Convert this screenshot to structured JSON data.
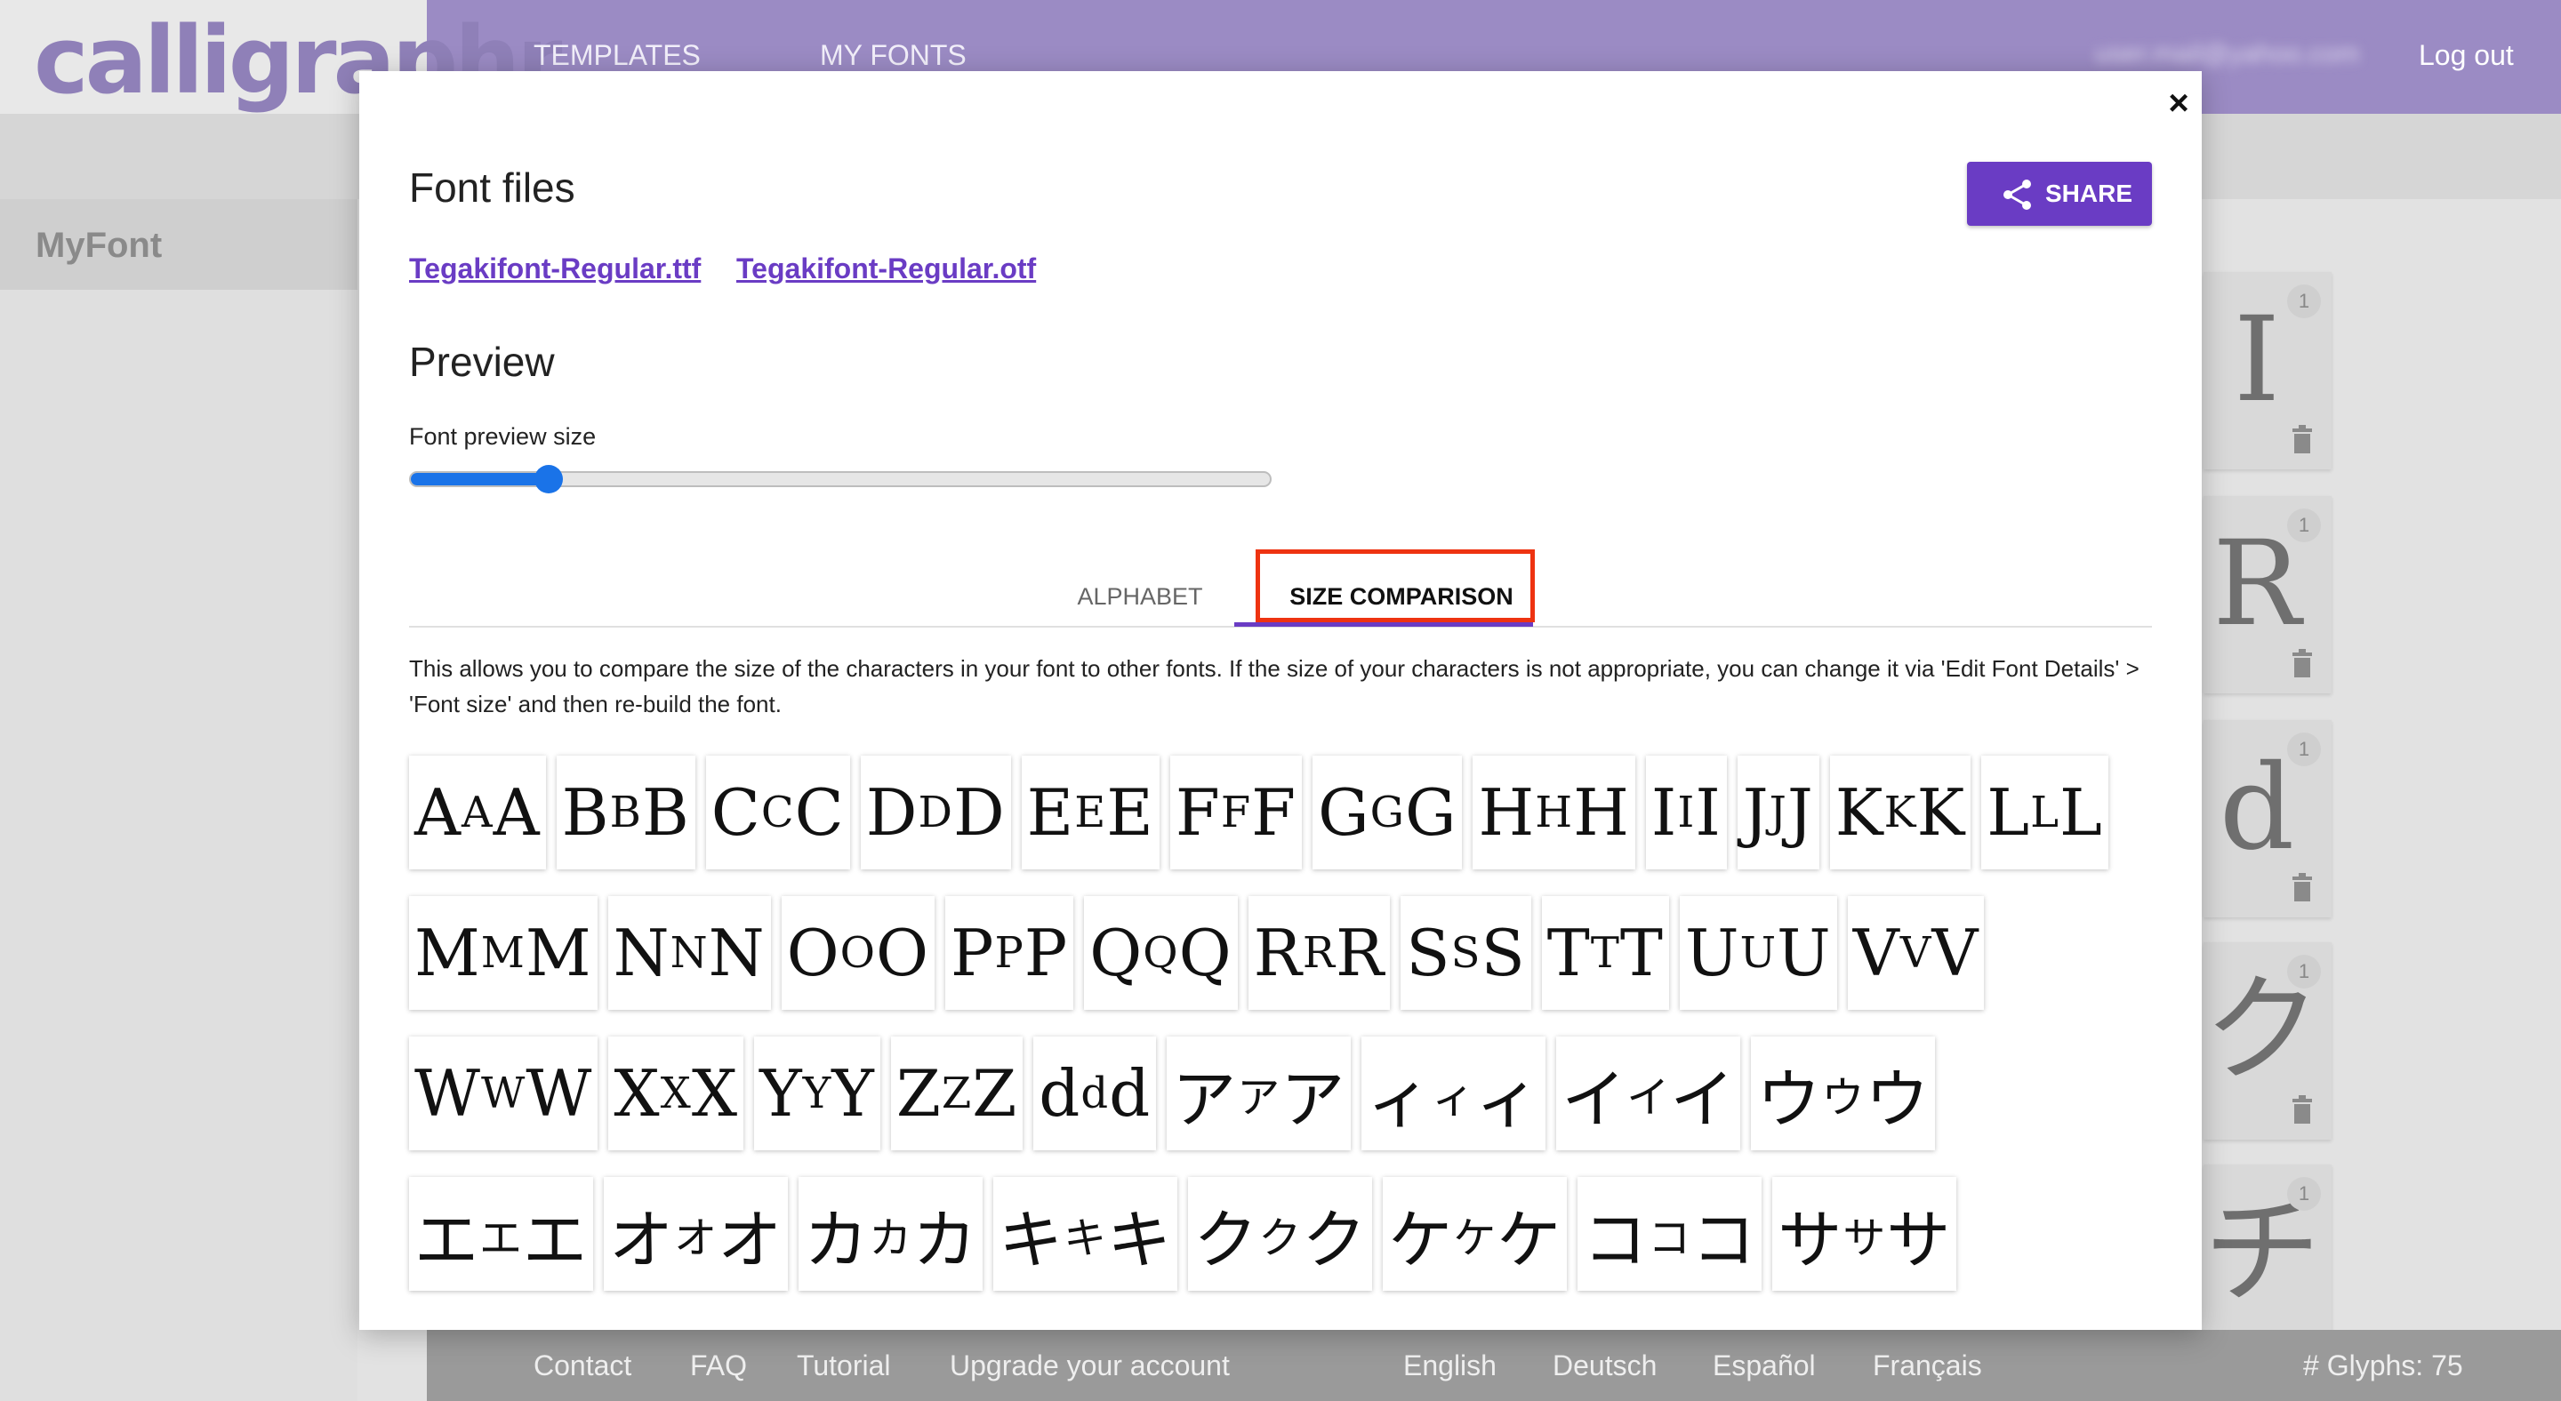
{
  "app": {
    "logo_text": "calligraphr",
    "nav": [
      "TEMPLATES",
      "MY FONTS"
    ],
    "user_email": "user.mail@yahoo.com",
    "logout_label": "Log out",
    "sidebar_font": "MyFont",
    "glyph_cards": [
      {
        "char": "I",
        "count": "1"
      },
      {
        "char": "R",
        "count": "1"
      },
      {
        "char": "d",
        "count": "1"
      },
      {
        "char": "ク",
        "count": "1"
      },
      {
        "char": "チ",
        "count": "1"
      }
    ],
    "footer_links": [
      "Contact",
      "FAQ",
      "Tutorial",
      "Upgrade your account"
    ],
    "languages": [
      "English",
      "Deutsch",
      "Español",
      "Français"
    ],
    "glyph_count": "# Glyphs: 75"
  },
  "modal": {
    "close_label": "×",
    "font_files_title": "Font files",
    "share_label": "SHARE",
    "files": [
      "Tegakifont-Regular.ttf",
      "Tegakifont-Regular.otf"
    ],
    "preview_title": "Preview",
    "slider_label": "Font preview size",
    "slider_value": 0.16,
    "tabs": [
      "ALPHABET",
      "SIZE COMPARISON"
    ],
    "active_tab": "SIZE COMPARISON",
    "description": "This allows you to compare the size of the characters in your font to other fonts. If the size of your characters is not appropriate, you can change it via 'Edit Font Details' > 'Font size' and then re-build the font.",
    "comparison_rows": [
      [
        "A",
        "B",
        "C",
        "D",
        "E",
        "F",
        "G",
        "H",
        "I",
        "J",
        "K",
        "L"
      ],
      [
        "M",
        "N",
        "O",
        "P",
        "Q",
        "R",
        "S",
        "T",
        "U",
        "V"
      ],
      [
        "W",
        "X",
        "Y",
        "Z",
        "d",
        "ア",
        "ィ",
        "イ",
        "ウ"
      ],
      [
        "エ",
        "オ",
        "カ",
        "キ",
        "ク",
        "ケ",
        "コ",
        "サ"
      ]
    ]
  },
  "colors": {
    "topbar": "#9b8bc4",
    "accent": "#6a3cc4",
    "slider": "#1a73e8",
    "highlight": "#ee3311"
  }
}
